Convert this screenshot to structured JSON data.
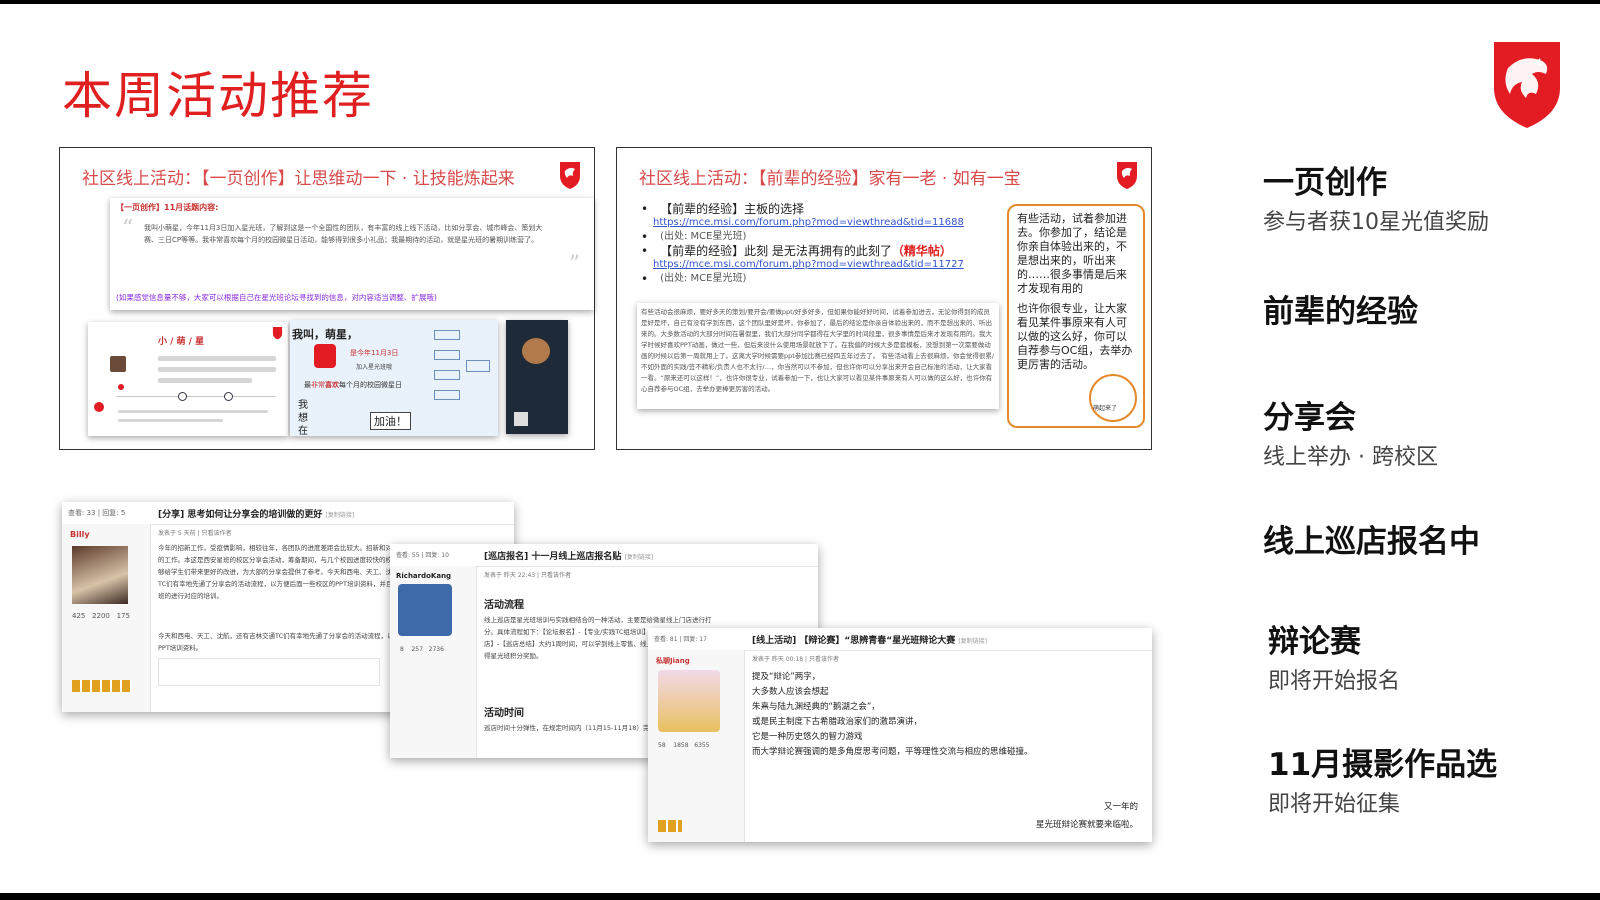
{
  "title": "本周活动推荐",
  "cards": {
    "left": {
      "title": "社区线上活动：【一页创作】让思维动一下 · 让技能炼起来",
      "inner_heading": "【一页创作】11月话题内容:",
      "inner_text": "我叫小萌星，今年11月3日加入星光班，了解到这是一个全国性的团队，有丰富的线上线下活动，比如分享会、城市峰会、策划大赛、三日CP等等。我非常喜欢每个月的校园微星日活动，能够得到很多小礼品；我最期待的活动，就是星光班的暑期训练营了。",
      "inner_footer": "(如果感觉信息量不够，大家可以根据自己在星光班论坛寻找到的信息，对内容适当调整、扩展哦)",
      "sample_a_title": "小 / 萌 / 星",
      "sample_b_title": "我叫，萌星，",
      "sample_b_date": "是今年11月3日",
      "sample_b_join": "加入星光班哦",
      "sample_b_like_a": "最",
      "sample_b_like_b": "非常",
      "sample_b_like_c": "喜欢",
      "sample_b_like_d": "每个月的校园微星日",
      "sample_b_go": "加油！",
      "sample_b_wo": "我",
      "sample_b_xiang": "想",
      "sample_b_zai": "在"
    },
    "right": {
      "title": "社区线上活动：【前辈的经验】家有一老 · 如有一宝",
      "b1_label": "【前辈的经验】主板的选择",
      "b1_link": "https://mce.msi.com/forum.php?mod=viewthread&tid=11688",
      "b1_src": "(出处: MCE星光班)",
      "b2_label": "【前辈的经验】此刻 是无法再拥有的此刻了",
      "b2_tag": "（精华帖）",
      "b2_link": "https://mce.msi.com/forum.php?mod=viewthread&tid=11727",
      "b2_src": "(出处: MCE星光班)",
      "note_p1": "有些活动，试着参加进去。你参加了，结论是你亲自体验出来的，不是想出来的，听出来的……很多事情是后来才发现有用的",
      "note_p2": "也许你很专业，让大家看见某件事原来有人可以做的这么好，你可以自荐参与OC组，去举办更厉害的活动。",
      "note_badge": "萌起来了",
      "quote_text": "有些活动会很麻烦，要好多天的策划/要开会/要做ppt/好多好多，但如果你能好好时间，试着参加进去，无论你得到的成员是好是坏，自己有没有学到东西，这个团队里好是坏，你参加了，最后的结论是你亲自体验出来的，而不是想出来的、听出来的。大多数活动的大部分时间在暑假里，我们大部分同学都得在大学里的时间段里，很多事情是后来才发现有用的。我大学时候好喜欢PPT动画，做过一些，但后来没什么使用场景就放下了。在我偏的时候大多是套模板，没想到第一次需要做动画的时候以后第一周就用上了。这离大学时候需要ppt参加比赛已经四五年过去了。 有些活动看上去很麻烦，你会觉得很累/不如外面的实践/签不精彩/负责人也不太行/…，你当然可以不参加，但也许你可以分享出来开会自己标准的活动，让大家看一看。“原来还可以这样！”，也许你很专业，试着参加一下，也让大家可以看见某件事原来有人可以做的这么好，也许你有心自荐参与OC组，去举办更棒更厉害的活动。"
    }
  },
  "right_list": [
    {
      "heading": "一页创作",
      "sub": "参与者获10星光值奖励"
    },
    {
      "heading": "前辈的经验",
      "sub": ""
    },
    {
      "heading": "分享会",
      "sub": "线上举办 · 跨校区"
    },
    {
      "heading": "线上巡店报名中",
      "sub": ""
    },
    {
      "heading": "辩论赛",
      "sub": "即将开始报名"
    },
    {
      "heading": "11月摄影作品选",
      "sub": "即将开始征集"
    }
  ],
  "posts": {
    "p1": {
      "stats": "查看: 33 | 回复: 5",
      "title": "[分享] 思考如何让分享会的培训做的更好",
      "tag": "[复制链接]",
      "user": "Billy",
      "meta": "发表于 5 天前 | 只看该作者",
      "body": "今年的招新工作，受疫情影响，相较往年，各团队的进度差距会比较大。招新和对新生的培训，是最重要的工作。本这是西安星班的校区分享会活动，筹备期间，与几个校园进度较快的校区交流之后，分享会能够给学生们带来更好的改进，为大部的分享会提供了参考。今天和西电、天工、沈航、还有吉林交通等TC们有幸地先通了分享会的活动流程，以方便后面一些校区的PPT培训资料，并且在校区内为21级星光班的进行对应的培训。",
      "footer": "今天和西电、天工、沈航，还有吉林交通TC们有幸地先通了分享会的活动流程，以方便后面一些校区的PPT培训资料。",
      "n1": "425",
      "n2": "2200",
      "n3": "175"
    },
    "p2": {
      "stats": "查看: 55 | 回复: 10",
      "title": "[巡店报名] 十一月线上巡店报名贴",
      "tag": "[复制链接]",
      "user": "RichardoKang",
      "meta": "发表于 昨天 22:43 | 只看该作者",
      "h1": "活动流程",
      "body": "线上巡店是星光班培训与实践相结合的一种活动，主要是给微星线上门店进行打分。具体流程如下：【论坛报名】-【专业/实践TC组培训】-【群内答疑】-【完成巡店】-【巡店总结】大约1周时间，可以学到线上零售、线上店铺管理模式、并能获得星光班积分奖励。",
      "h2": "活动时间",
      "body2": "巡店时间十分弹性，在规定时间内（11月15-11月18）完成即可。",
      "n1": "8",
      "n2": "257",
      "n3": "2736"
    },
    "p3": {
      "stats": "查看: 81 | 回复: 17",
      "title": "[线上活动] 【辩论赛】“思辨青春“星光班辩论大赛",
      "tag": "[复制链接]",
      "user": "私聊Jiang",
      "meta": "发表于 昨天 00:18 | 只看该作者",
      "lines": [
        "提及“辩论”两字，",
        "大多数人应该会想起",
        "朱熹与陆九渊经典的“鹅湖之会”，",
        "或是民主制度下古希腊政治家们的激昂演讲，",
        "它是一种历史悠久的智力游戏",
        "而大学辩论赛强调的是多角度思考问题，平等理性交流与相应的思维碰撞。"
      ],
      "tail1": "又一年的",
      "tail2": "星光班辩论赛就要来临啦。",
      "n1": "58",
      "n2": "1858",
      "n3": "6355"
    }
  }
}
